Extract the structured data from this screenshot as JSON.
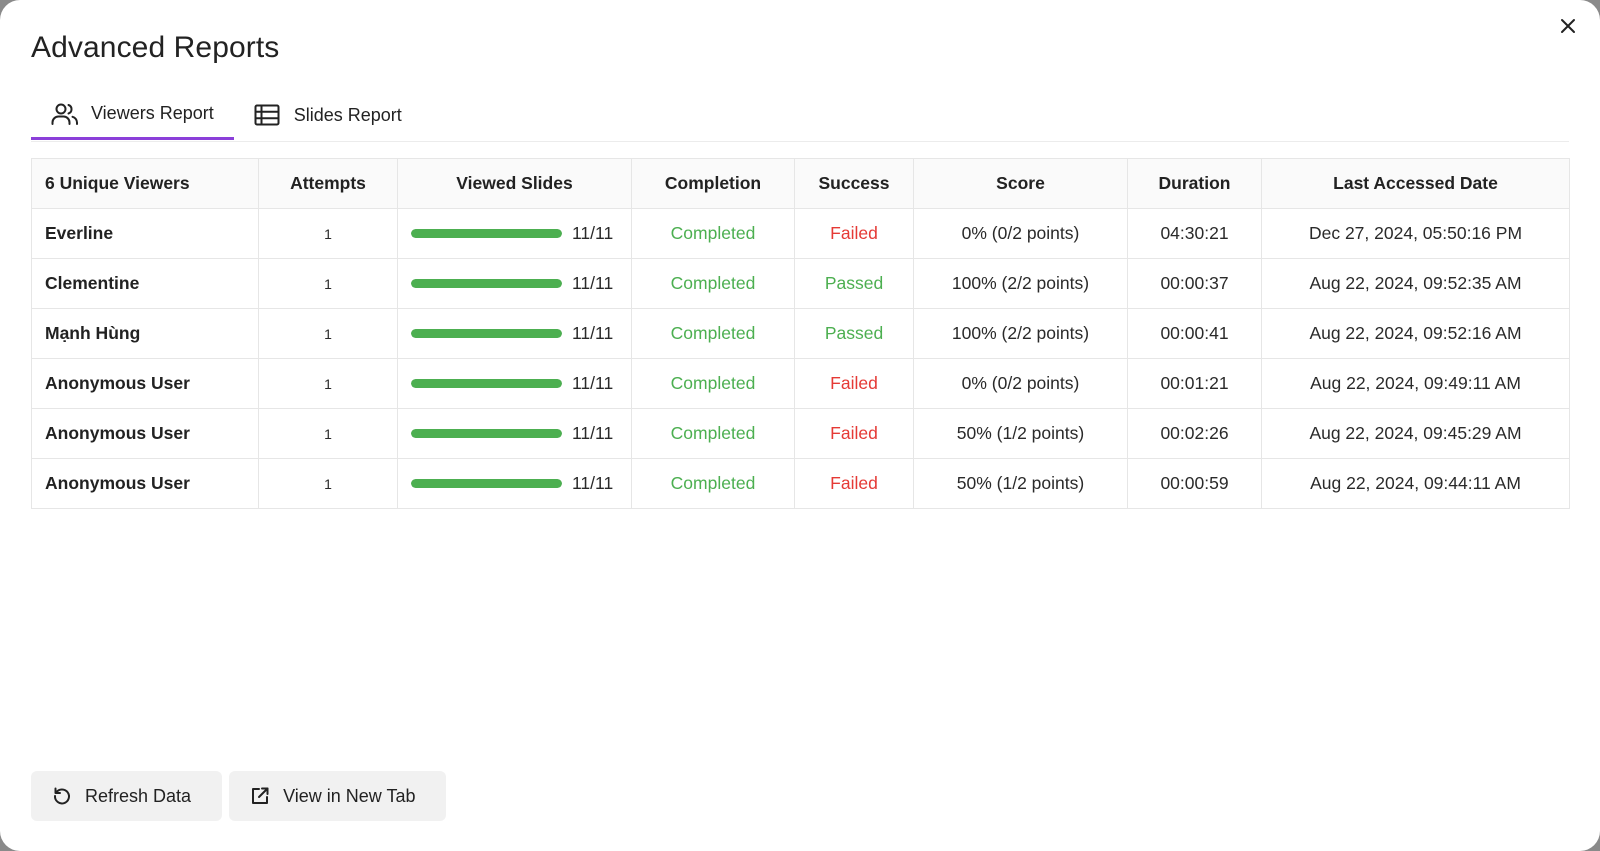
{
  "dialog": {
    "title": "Advanced Reports"
  },
  "tabs": [
    {
      "label": "Viewers Report",
      "icon": "users-icon",
      "active": true
    },
    {
      "label": "Slides Report",
      "icon": "table-list-icon",
      "active": false
    }
  ],
  "table": {
    "headers": [
      "6 Unique Viewers",
      "Attempts",
      "Viewed Slides",
      "Completion",
      "Success",
      "Score",
      "Duration",
      "Last Accessed Date"
    ],
    "rows": [
      {
        "name": "Everline",
        "attempts": "1",
        "viewed_fraction": 1.0,
        "viewed_text": "11/11",
        "completion": "Completed",
        "success": "Failed",
        "score": "0% (0/2 points)",
        "duration": "04:30:21",
        "last_accessed": "Dec 27, 2024, 05:50:16 PM"
      },
      {
        "name": "Clementine",
        "attempts": "1",
        "viewed_fraction": 1.0,
        "viewed_text": "11/11",
        "completion": "Completed",
        "success": "Passed",
        "score": "100% (2/2 points)",
        "duration": "00:00:37",
        "last_accessed": "Aug 22, 2024, 09:52:35 AM"
      },
      {
        "name": "Mạnh Hùng",
        "attempts": "1",
        "viewed_fraction": 1.0,
        "viewed_text": "11/11",
        "completion": "Completed",
        "success": "Passed",
        "score": "100% (2/2 points)",
        "duration": "00:00:41",
        "last_accessed": "Aug 22, 2024, 09:52:16 AM"
      },
      {
        "name": "Anonymous User",
        "attempts": "1",
        "viewed_fraction": 1.0,
        "viewed_text": "11/11",
        "completion": "Completed",
        "success": "Failed",
        "score": "0% (0/2 points)",
        "duration": "00:01:21",
        "last_accessed": "Aug 22, 2024, 09:49:11 AM"
      },
      {
        "name": "Anonymous User",
        "attempts": "1",
        "viewed_fraction": 1.0,
        "viewed_text": "11/11",
        "completion": "Completed",
        "success": "Failed",
        "score": "50% (1/2 points)",
        "duration": "00:02:26",
        "last_accessed": "Aug 22, 2024, 09:45:29 AM"
      },
      {
        "name": "Anonymous User",
        "attempts": "1",
        "viewed_fraction": 1.0,
        "viewed_text": "11/11",
        "completion": "Completed",
        "success": "Failed",
        "score": "50% (1/2 points)",
        "duration": "00:00:59",
        "last_accessed": "Aug 22, 2024, 09:44:11 AM"
      }
    ]
  },
  "footer": {
    "refresh_label": "Refresh Data",
    "refresh_icon": "refresh-icon",
    "new_tab_label": "View in New Tab",
    "new_tab_icon": "external-link-icon"
  },
  "colors": {
    "accent": "#8b3fd9",
    "success": "#4caf50",
    "failure": "#e53935",
    "progress": "#4caf50"
  }
}
